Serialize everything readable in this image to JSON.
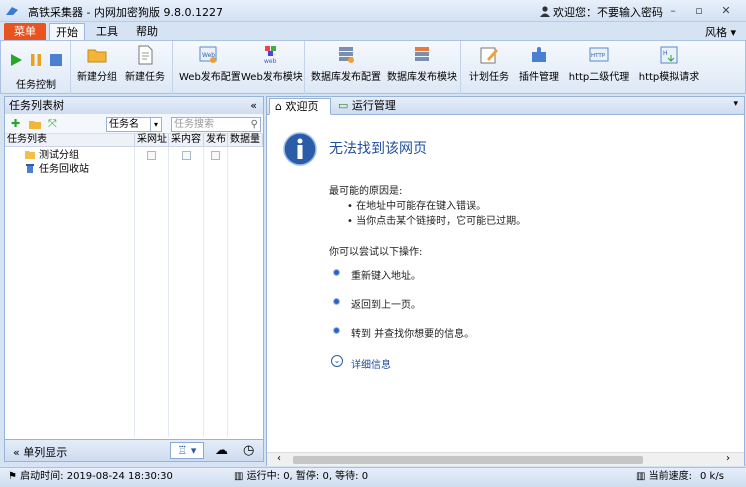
{
  "app": {
    "title": "高铁采集器 - 内网加密狗版 9.8.0.1227",
    "user_text": "欢迎您：不要输入密码",
    "style_label": "风格"
  },
  "tabs": {
    "menu": "菜单",
    "items": [
      "开始",
      "工具",
      "帮助"
    ]
  },
  "ribbon": {
    "task_control_label": "任务控制",
    "buttons": [
      "新建分组",
      "新建任务",
      "Web发布配置",
      "Web发布模块",
      "数据库发布配置",
      "数据库发布模块",
      "计划任务",
      "插件管理",
      "http二级代理",
      "http模拟请求"
    ]
  },
  "left_panel": {
    "title": "任务列表树",
    "dropdown_value": "任务名",
    "search_placeholder": "任务搜索",
    "columns": [
      "任务列表",
      "采网址",
      "采内容",
      "发布",
      "数据量"
    ],
    "tree": [
      "测试分组",
      "任务回收站"
    ],
    "footer_label": "单列显示"
  },
  "content": {
    "tabs": [
      "欢迎页",
      "运行管理"
    ],
    "error": {
      "title": "无法找到该网页",
      "reason_head": "最可能的原因是:",
      "reasons": [
        "• 在地址中可能存在键入错误。",
        "• 当你点击某个链接时，它可能已过期。"
      ],
      "try_head": "你可以尝试以下操作:",
      "actions": [
        "重新键入地址。",
        "返回到上一页。",
        "转到  并查找你想要的信息。"
      ],
      "details": "详细信息"
    }
  },
  "status": {
    "start_time": "启动时间: 2019-08-24 18:30:30",
    "running": "运行中: 0,  暂停: 0,  等待: 0",
    "speed_label": "当前速度:",
    "speed_value": "0  k/s"
  }
}
